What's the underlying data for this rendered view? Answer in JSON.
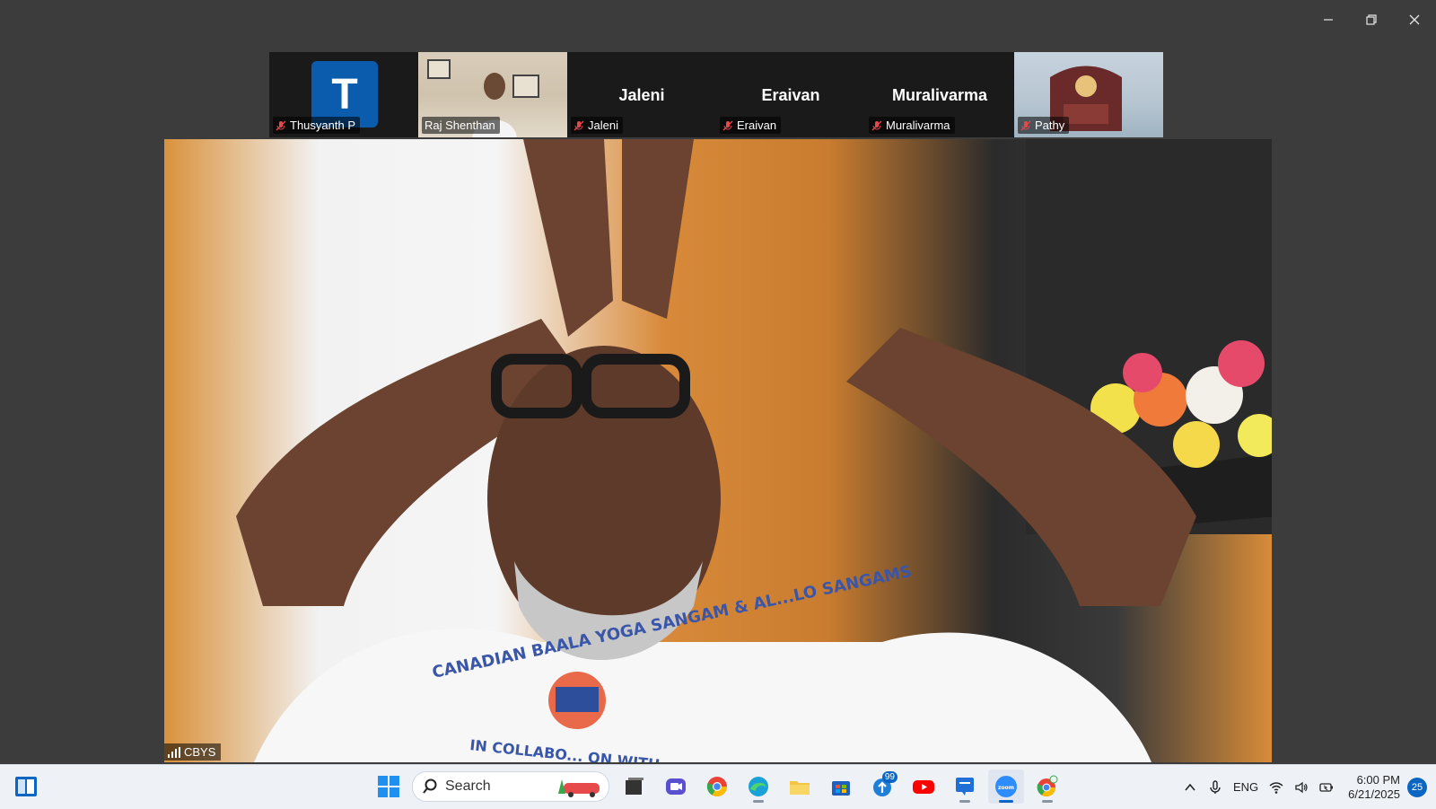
{
  "window": {
    "controls": [
      "minimize",
      "restore",
      "close"
    ]
  },
  "participants": [
    {
      "name": "Thusyanth P",
      "avatar_letter": "T",
      "muted": true,
      "video": false
    },
    {
      "name": "Raj Shenthan",
      "muted": false,
      "video": true
    },
    {
      "name": "Jaleni",
      "display_name": "Jaleni",
      "muted": true,
      "video": false
    },
    {
      "name": "Eraivan",
      "display_name": "Eraivan",
      "muted": true,
      "video": false
    },
    {
      "name": "Muralivarma",
      "display_name": "Muralivarma",
      "muted": true,
      "video": false
    },
    {
      "name": "Pathy",
      "muted": true,
      "video": true
    }
  ],
  "main_video": {
    "label": "CBYS",
    "shirt_text_top": "CANADIAN BAALA YOGA SANGAM & AL...LO SANGAMS",
    "shirt_text_bottom": "IN COLLABO... ON WITH"
  },
  "taskbar": {
    "search_label": "Search",
    "apps": [
      {
        "icon": "windows-start-icon",
        "active": false
      },
      {
        "icon": "task-view-icon",
        "active": false
      },
      {
        "icon": "meet-icon",
        "active": false
      },
      {
        "icon": "chrome-icon",
        "active": false
      },
      {
        "icon": "edge-icon",
        "active": false
      },
      {
        "icon": "file-explorer-icon",
        "active": false
      },
      {
        "icon": "store-icon",
        "active": false
      },
      {
        "icon": "teams-icon",
        "badge": "99",
        "active": false
      },
      {
        "icon": "youtube-icon",
        "active": false
      },
      {
        "icon": "chat-icon",
        "active": false
      },
      {
        "icon": "zoom-icon",
        "active": true
      },
      {
        "icon": "chrome-profile-icon",
        "active": false
      }
    ],
    "tray": {
      "language": "ENG",
      "time": "6:00 PM",
      "date": "6/21/2025",
      "notifications": "25"
    }
  },
  "colors": {
    "background": "#3c3c3c",
    "tile": "#1a1a1a",
    "avatar": "#0b5cad",
    "muted_red": "#e5484d",
    "taskbar": "#eef2f7",
    "accent": "#0a66c2"
  }
}
